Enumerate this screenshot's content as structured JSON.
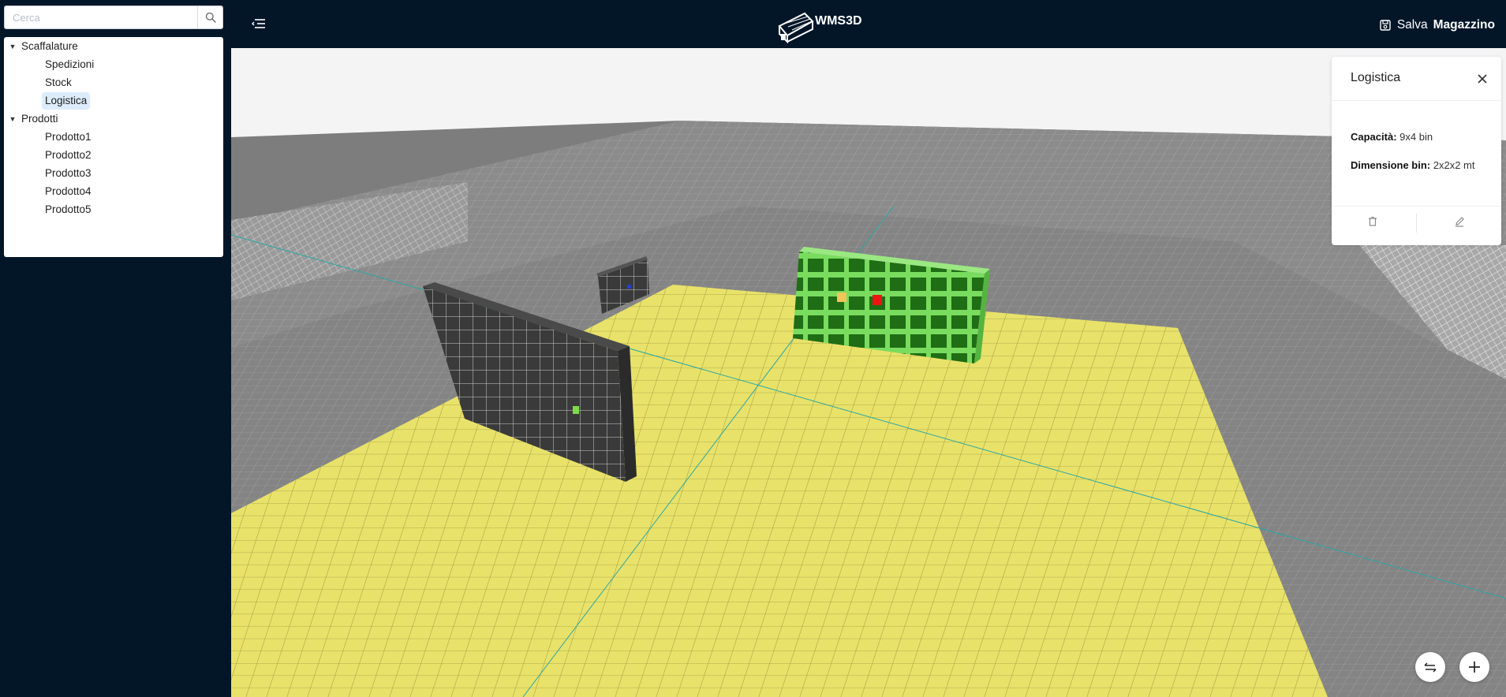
{
  "app": {
    "logo_text": "WMS3D"
  },
  "search": {
    "placeholder": "Cerca"
  },
  "tree": {
    "groups": [
      {
        "label": "Scaffalature",
        "items": [
          "Spedizioni",
          "Stock",
          "Logistica"
        ]
      },
      {
        "label": "Prodotti",
        "items": [
          "Prodotto1",
          "Prodotto2",
          "Prodotto3",
          "Prodotto4",
          "Prodotto5"
        ]
      }
    ],
    "selected": "Logistica"
  },
  "header": {
    "save_label": "Salva",
    "save_bold": "Magazzino"
  },
  "panel": {
    "title": "Logistica",
    "capacity_label": "Capacità:",
    "capacity_value": "9x4 bin",
    "bin_label": "Dimensione bin:",
    "bin_value": "2x2x2 mt"
  },
  "colors": {
    "nav_bg": "#021628",
    "floor_yellow": "#e8e26a",
    "ground_gray": "#8a8a8a",
    "rack_dark": "#3a3a3a",
    "rack_selected": "#5fd24a",
    "selection_bg": "#dcecfb"
  },
  "icons": [
    "search-icon",
    "menu-toggle-icon",
    "save-icon",
    "close-icon",
    "trash-icon",
    "edit-icon",
    "swap-icon",
    "plus-icon",
    "warehouse-icon"
  ]
}
